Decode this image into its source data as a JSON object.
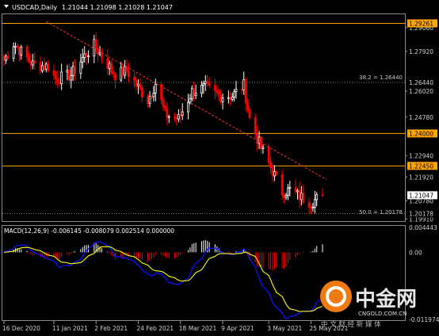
{
  "header": {
    "symbol_text": "USDCAD,Daily",
    "quotes_text": "1.21044 1.21098 1.21028 1.21047"
  },
  "macd_header": {
    "text": "MACD(12,26,9) -0.006145 -0.008079 0.002514 0.000000"
  },
  "price_axis": {
    "ticks": [
      "1.29060",
      "1.27920",
      "1.26020",
      "1.24780",
      "1.22940",
      "1.21920",
      "1.20780",
      "1.19910"
    ],
    "tags": [
      {
        "label": "1.29261",
        "style": "box"
      },
      {
        "label": "1.26440",
        "style": "plain"
      },
      {
        "label": "1.24000",
        "style": "box"
      },
      {
        "label": "1.22450",
        "style": "box"
      },
      {
        "label": "1.21047",
        "style": "current"
      },
      {
        "label": "1.20178",
        "style": "plain"
      }
    ]
  },
  "macd_axis": {
    "ticks": [
      "0.004443",
      "0.00",
      "-0.011974"
    ]
  },
  "x_axis": {
    "ticks": [
      "16 Dec 2020",
      "11 Jan 2021",
      "2 Feb 2021",
      "24 Feb 2021",
      "18 Mar 2021",
      "9 Apr 2021",
      "3 May 2021",
      "25 May 2021"
    ]
  },
  "annotations": {
    "fib_382": "38.2 = 1.26440",
    "fib_500": "50.0 = 1.20178"
  },
  "watermark": {
    "brand": "中金网",
    "url": "CNGOLD.COM.CN",
    "tagline": "中 文 财 经 新 媒 体"
  },
  "colors": {
    "background": "#000000",
    "candle_up": "#ffffff",
    "candle_down": "#ff0000",
    "level_line": "#ffa500",
    "trendline": "#ff3030",
    "macd_hist_up": "#ffffff",
    "macd_hist_down": "#ff0000",
    "macd_signal": "#ffff00",
    "macd_main": "#1010ff"
  },
  "chart_data": [
    {
      "type": "candlestick",
      "symbol": "USDCAD",
      "timeframe": "Daily",
      "x_range": [
        "2020-12-16",
        "2021-05-31"
      ],
      "ylim": [
        1.1985,
        1.2962
      ],
      "horizontal_levels": [
        1.29261,
        1.24,
        1.2245
      ],
      "fibonacci_levels": [
        {
          "ratio": 38.2,
          "value": 1.2644
        },
        {
          "ratio": 50.0,
          "value": 1.20178
        }
      ],
      "trendline": {
        "from": {
          "date": "2021-01-07",
          "value": 1.2935
        },
        "to": {
          "date": "2021-06-02",
          "value": 1.218
        }
      },
      "last_close": 1.21047,
      "close_path": [
        [
          "2020-12-16",
          1.275
        ],
        [
          "2020-12-21",
          1.283
        ],
        [
          "2020-12-24",
          1.28
        ],
        [
          "2020-12-31",
          1.273
        ],
        [
          "2021-01-08",
          1.272
        ],
        [
          "2021-01-12",
          1.266
        ],
        [
          "2021-01-20",
          1.268
        ],
        [
          "2021-01-26",
          1.276
        ],
        [
          "2021-02-01",
          1.282
        ],
        [
          "2021-02-05",
          1.277
        ],
        [
          "2021-02-12",
          1.268
        ],
        [
          "2021-02-18",
          1.27
        ],
        [
          "2021-02-24",
          1.262
        ],
        [
          "2021-03-01",
          1.256
        ],
        [
          "2021-03-05",
          1.264
        ],
        [
          "2021-03-10",
          1.249
        ],
        [
          "2021-03-17",
          1.247
        ],
        [
          "2021-03-24",
          1.26
        ],
        [
          "2021-03-31",
          1.262
        ],
        [
          "2021-04-07",
          1.258
        ],
        [
          "2021-04-14",
          1.258
        ],
        [
          "2021-04-20",
          1.263
        ],
        [
          "2021-04-23",
          1.247
        ],
        [
          "2021-04-29",
          1.233
        ],
        [
          "2021-05-05",
          1.222
        ],
        [
          "2021-05-10",
          1.212
        ],
        [
          "2021-05-14",
          1.213
        ],
        [
          "2021-05-19",
          1.21
        ],
        [
          "2021-05-25",
          1.207
        ],
        [
          "2021-05-31",
          1.2105
        ]
      ]
    },
    {
      "type": "macd",
      "params": [
        12,
        26,
        9
      ],
      "values": {
        "main": -0.006145,
        "signal": -0.008079,
        "histogram": 0.002514,
        "extra": 0.0
      },
      "ylim": [
        -0.011974,
        0.004443
      ]
    }
  ]
}
